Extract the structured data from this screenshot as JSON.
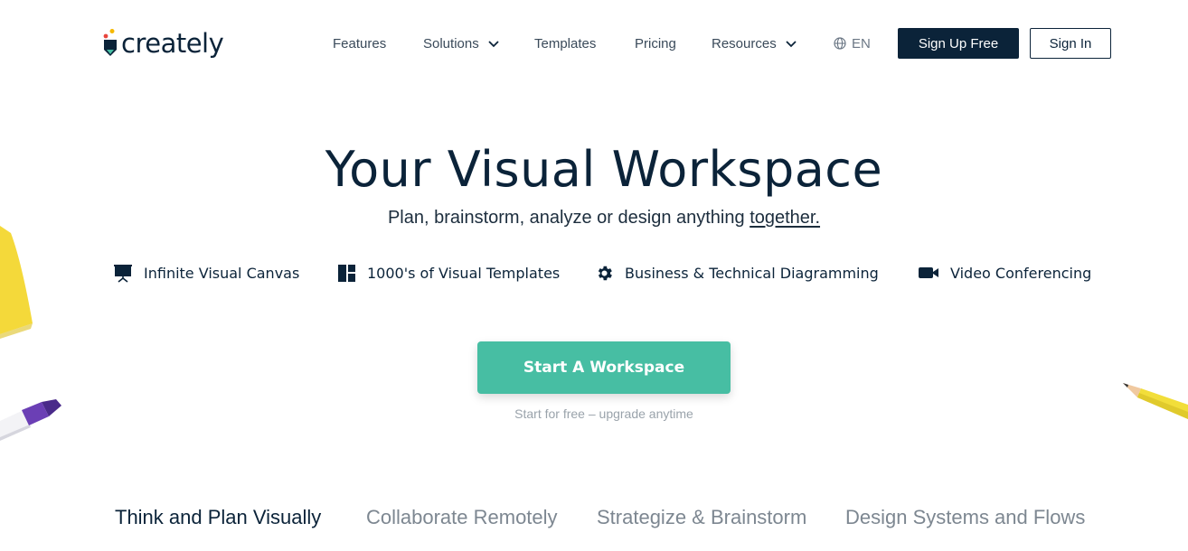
{
  "header": {
    "logo_text": "creately",
    "nav": [
      {
        "label": "Features",
        "has_menu": false
      },
      {
        "label": "Solutions",
        "has_menu": true
      },
      {
        "label": "Templates",
        "has_menu": false
      },
      {
        "label": "Pricing",
        "has_menu": false
      },
      {
        "label": "Resources",
        "has_menu": true
      }
    ],
    "language": "EN",
    "signup_label": "Sign Up Free",
    "signin_label": "Sign In"
  },
  "hero": {
    "title": "Your Visual Workspace",
    "subtitle_main": "Plan, brainstorm, analyze or design anything ",
    "subtitle_link": "together.",
    "features": [
      {
        "icon": "presentation-board-icon",
        "label": "Infinite Visual Canvas"
      },
      {
        "icon": "template-grid-icon",
        "label": "1000's of Visual Templates"
      },
      {
        "icon": "gear-icon",
        "label": "Business & Technical Diagramming"
      },
      {
        "icon": "video-camera-icon",
        "label": "Video Conferencing"
      }
    ],
    "cta_label": "Start A Workspace",
    "cta_note": "Start for free – upgrade anytime"
  },
  "tabs": [
    {
      "label": "Think and Plan Visually",
      "active": true
    },
    {
      "label": "Collaborate Remotely",
      "active": false
    },
    {
      "label": "Strategize & Brainstorm",
      "active": false
    },
    {
      "label": "Design Systems and Flows",
      "active": false
    }
  ],
  "colors": {
    "navy": "#0b2339",
    "accent": "#47bea3",
    "muted": "#7d8791"
  }
}
